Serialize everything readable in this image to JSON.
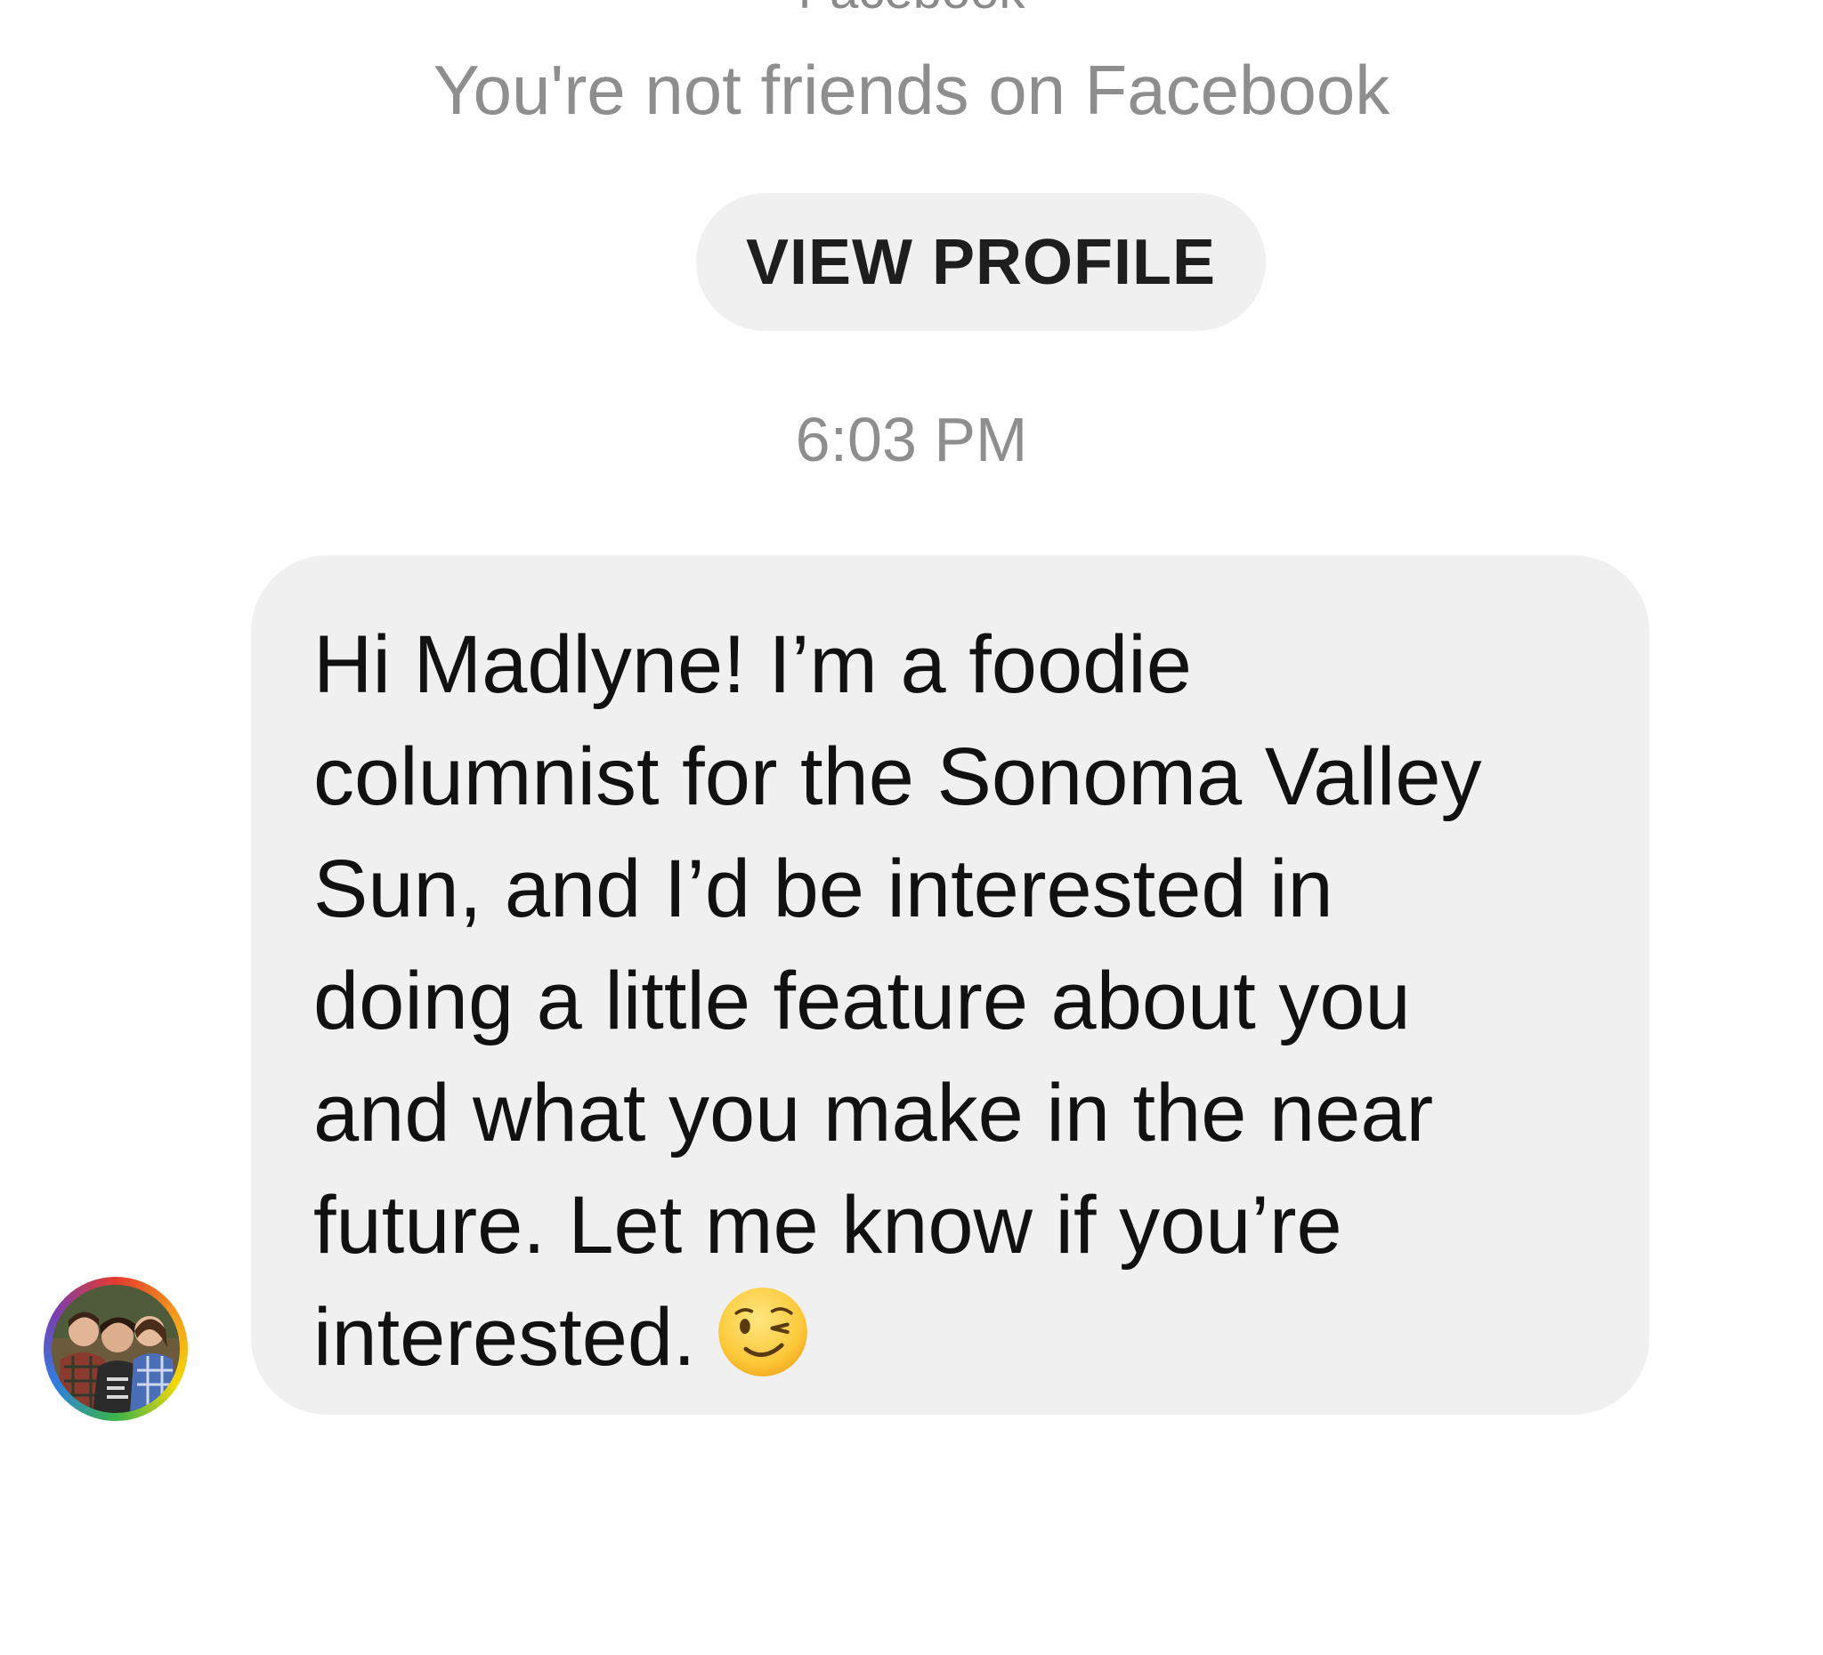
{
  "header": {
    "cut_off_title": "Facebook",
    "not_friends_text": "You're not friends on Facebook",
    "view_profile_label": "VIEW PROFILE"
  },
  "conversation": {
    "timestamp": "6:03 PM",
    "messages": [
      {
        "sender": "incoming",
        "lines": [
          "Hi Madlyne! I’m a foodie",
          "columnist for the Sonoma Valley",
          "Sun, and I’d be interested in",
          "doing a little feature about you",
          "and what you make in the near",
          "future. Let me know if you’re",
          "interested."
        ],
        "emoji": "winking-face"
      }
    ]
  },
  "colors": {
    "bubble": "#f0f0f0",
    "secondary_text": "#8e8e8e",
    "primary_text": "#111111",
    "avatar_ring": [
      "#e33b2e",
      "#f39a1f",
      "#f5d90a",
      "#3ab54a",
      "#2f7de1",
      "#7a3fb0"
    ]
  }
}
